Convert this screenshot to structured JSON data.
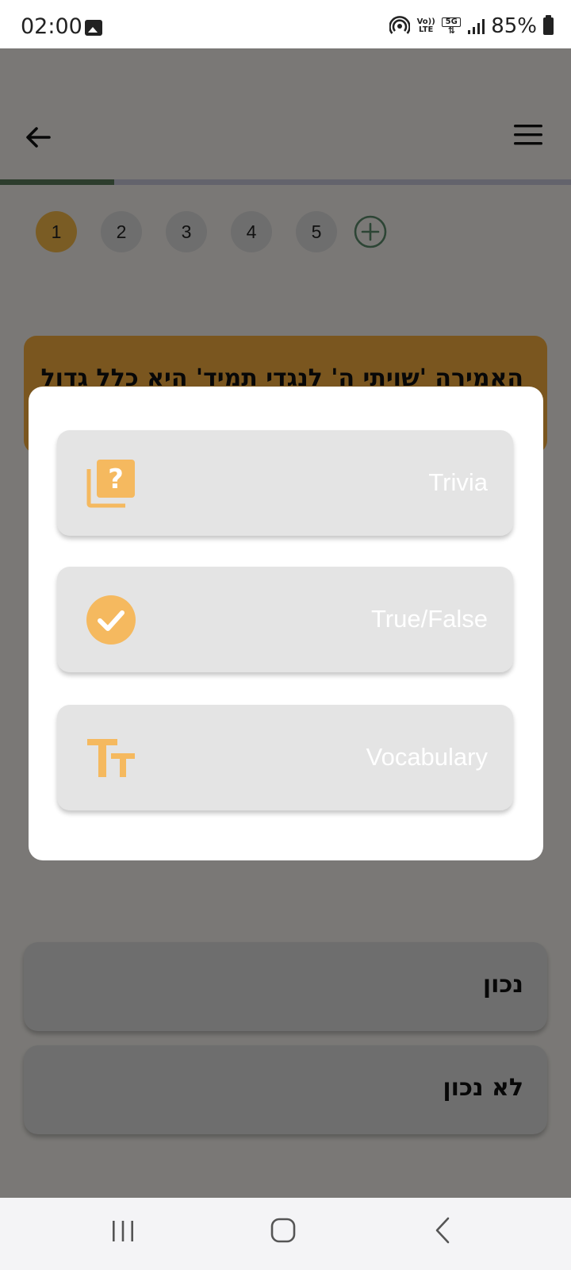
{
  "status_bar": {
    "time": "02:00",
    "volte_top": "Vo))",
    "volte_bottom": "LTE",
    "net_type": "5G",
    "battery": "85%"
  },
  "top_bar": {
    "back_icon": "arrow-left-icon",
    "menu_icon": "hamburger-menu-icon"
  },
  "progress": {
    "fraction": 0.2
  },
  "question_tabs": [
    "1",
    "2",
    "3",
    "4",
    "5"
  ],
  "question": {
    "text": "האמירה 'שויתי ה' לנגדי תמיד' היא כלל גדול"
  },
  "answers": [
    "נכון",
    "לא נכון"
  ],
  "dialog": {
    "options": [
      {
        "label": "Trivia",
        "icon": "question-cards-icon"
      },
      {
        "label": "True/False",
        "icon": "check-circle-icon"
      },
      {
        "label": "Vocabulary",
        "icon": "text-size-icon"
      }
    ]
  },
  "colors": {
    "accent": "#f5b849",
    "icon_orange": "#f5b95f",
    "progress": "#5a7a5a"
  }
}
